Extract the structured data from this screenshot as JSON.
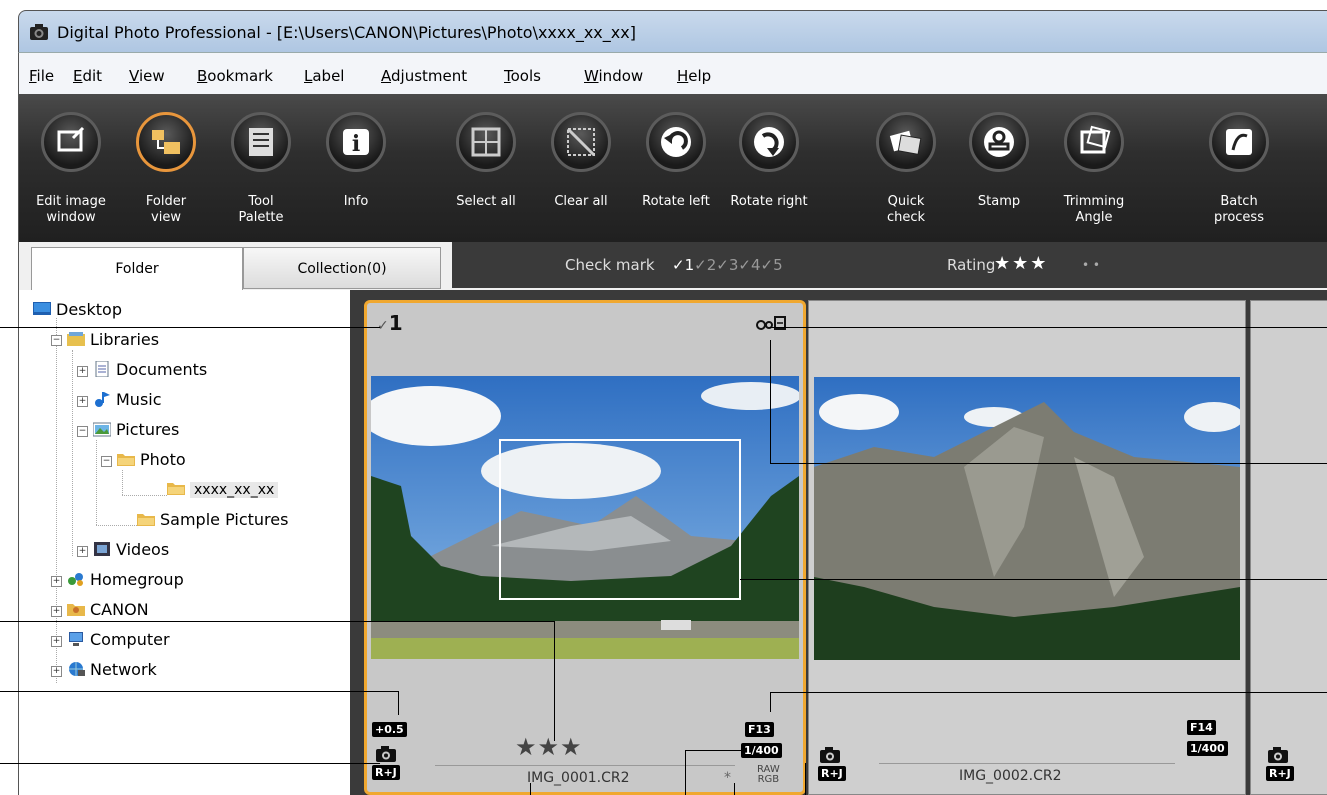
{
  "window": {
    "title": "Digital Photo Professional - [E:\\Users\\CANON\\Pictures\\Photo\\xxxx_xx_xx]"
  },
  "menu": [
    {
      "label": "File",
      "mn": "F",
      "rest": "ile"
    },
    {
      "label": "Edit",
      "mn": "E",
      "rest": "dit"
    },
    {
      "label": "View",
      "mn": "V",
      "rest": "iew"
    },
    {
      "label": "Bookmark",
      "mn": "B",
      "rest": "ookmark"
    },
    {
      "label": "Label",
      "mn": "L",
      "rest": "abel"
    },
    {
      "label": "Adjustment",
      "mn": "A",
      "rest": "djustment"
    },
    {
      "label": "Tools",
      "mn": "T",
      "rest": "ools"
    },
    {
      "label": "Window",
      "mn": "W",
      "rest": "indow"
    },
    {
      "label": "Help",
      "mn": "H",
      "rest": "elp"
    }
  ],
  "toolbar": [
    {
      "label": "Edit image\nwindow",
      "icon": "edit-image-icon"
    },
    {
      "label": "Folder\nview",
      "icon": "folder-view-icon",
      "active": true
    },
    {
      "label": "Tool\nPalette",
      "icon": "tool-palette-icon"
    },
    {
      "label": "Info",
      "icon": "info-icon"
    },
    {
      "label": "Select all",
      "icon": "select-all-icon"
    },
    {
      "label": "Clear all",
      "icon": "clear-all-icon"
    },
    {
      "label": "Rotate left",
      "icon": "rotate-left-icon"
    },
    {
      "label": "Rotate right",
      "icon": "rotate-right-icon"
    },
    {
      "label": "Quick\ncheck",
      "icon": "quick-check-icon"
    },
    {
      "label": "Stamp",
      "icon": "stamp-icon"
    },
    {
      "label": "Trimming\nAngle",
      "icon": "trimming-angle-icon"
    },
    {
      "label": "Batch\nprocess",
      "icon": "batch-process-icon"
    }
  ],
  "tabs": {
    "folder": "Folder",
    "collection": "Collection(0)"
  },
  "filter": {
    "check_mark_label": "Check mark",
    "check_marks": [
      "1",
      "2",
      "3",
      "4",
      "5"
    ],
    "rating_label": "Rating",
    "rating_stars": "★★★",
    "rating_empty": "• •"
  },
  "tree": {
    "desktop": "Desktop",
    "libraries": "Libraries",
    "documents": "Documents",
    "music": "Music",
    "pictures": "Pictures",
    "photo": "Photo",
    "date_folder": "xxxx_xx_xx",
    "sample_pictures": "Sample Pictures",
    "videos": "Videos",
    "homegroup": "Homegroup",
    "canon": "CANON",
    "computer": "Computer",
    "network": "Network"
  },
  "thumbnails": [
    {
      "check": "1",
      "filename": "IMG_0001.CR2",
      "rating": "★★★",
      "exposure_comp": "+0.5",
      "aperture": "F13",
      "shutter": "1/400",
      "format_badge": "R+J",
      "raw_label": "RAW",
      "rgb_label": "RGB",
      "edited_mark": "*"
    },
    {
      "filename": "IMG_0002.CR2",
      "aperture": "F14",
      "shutter": "1/400",
      "format_badge": "R+J"
    }
  ],
  "colors": {
    "selection_border": "#f0a830",
    "toolbar_bg": "#2e2e2e",
    "filter_bg": "#3a3a3a"
  }
}
